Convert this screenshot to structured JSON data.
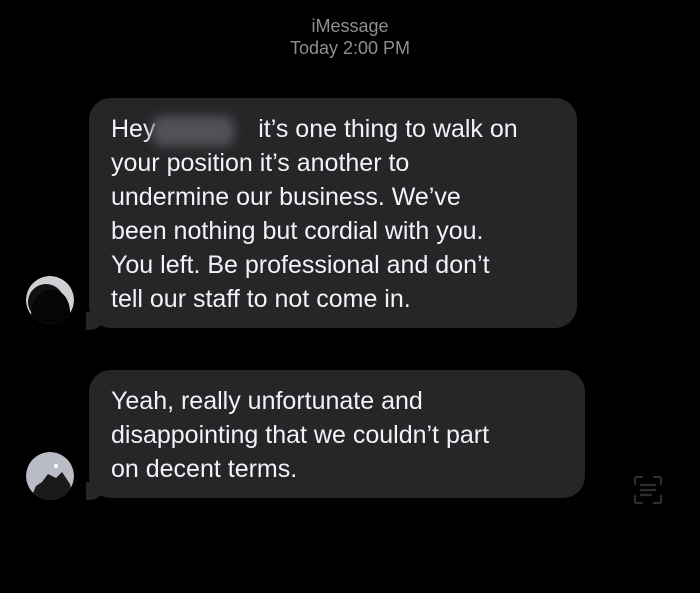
{
  "header": {
    "service": "iMessage",
    "timestamp": "Today 2:00 PM"
  },
  "messages": [
    {
      "sender": "",
      "text": "Hey       it’s one thing to walk on\nyour position it’s another to\nundermine our business. We’ve\nbeen nothing but cordial with you.\nYou left. Be professional and don’t\ntell our staff to not come in."
    },
    {
      "sender": "",
      "text": "Yeah, really unfortunate and\ndisappointing that we couldn’t part\non decent terms."
    }
  ],
  "icons": {
    "avatar_1": "contact-photo-icon",
    "avatar_2": "contact-photo-icon",
    "side": "live-text-icon"
  },
  "colors": {
    "background": "#000000",
    "bubble": "#262629",
    "header_text": "#8e8e93",
    "message_text": "#f2f2f7"
  }
}
